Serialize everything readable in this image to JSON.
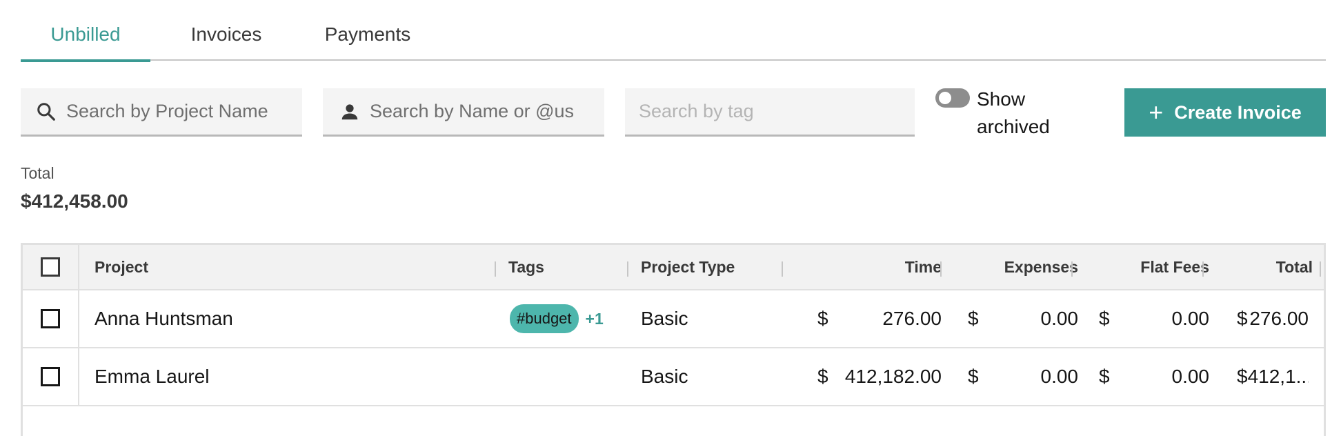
{
  "tabs": [
    {
      "label": "Unbilled",
      "active": true
    },
    {
      "label": "Invoices",
      "active": false
    },
    {
      "label": "Payments",
      "active": false
    }
  ],
  "filters": {
    "project_search_placeholder": "Search by Project Name",
    "name_search_placeholder": "Search by Name or @us",
    "tag_search_placeholder": "Search by tag",
    "show_archived_label": "Show archived",
    "show_archived_on": false
  },
  "create_button": {
    "label": "Create Invoice",
    "icon": "plus-icon"
  },
  "summary": {
    "total_label": "Total",
    "total_value": "$412,458.00"
  },
  "table": {
    "headers": {
      "project": "Project",
      "tags": "Tags",
      "project_type": "Project Type",
      "time": "Time",
      "expenses": "Expenses",
      "flat_fees": "Flat Fees",
      "total": "Total"
    },
    "currency_symbol": "$",
    "rows": [
      {
        "project": "Anna Huntsman",
        "tag": "#budget",
        "tag_more": "+1",
        "project_type": "Basic",
        "time": "276.00",
        "expenses": "0.00",
        "flat_fees": "0.00",
        "total": "276.00"
      },
      {
        "project": "Emma Laurel",
        "tag": "",
        "tag_more": "",
        "project_type": "Basic",
        "time": "412,182.00",
        "expenses": "0.00",
        "flat_fees": "0.00",
        "total": "412,1..."
      }
    ]
  },
  "colors": {
    "accent": "#3a9a93",
    "tag": "#4db6ac"
  }
}
